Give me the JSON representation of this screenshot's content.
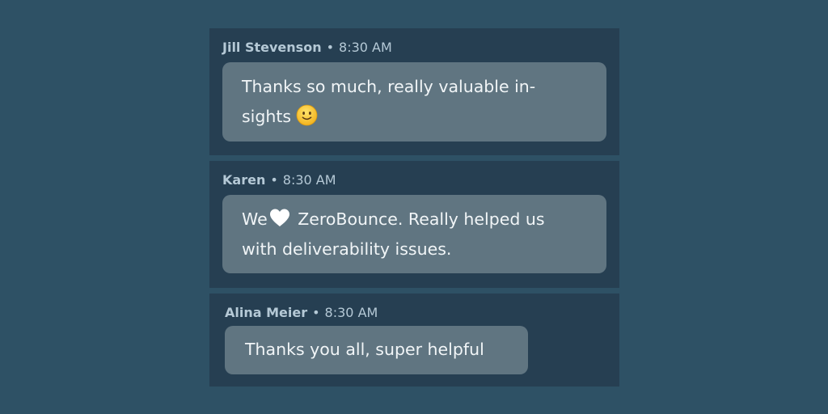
{
  "messages": [
    {
      "author": "Jill Stevenson",
      "separator": "•",
      "time": "8:30 AM",
      "text": "Thanks so much, really valuable in-sights",
      "text_line1": "Thanks so much, really valuable in-",
      "text_line2": "sights",
      "emoji": "slightly-smiling-face-icon"
    },
    {
      "author": "Karen",
      "separator": "•",
      "time": "8:30 AM",
      "text_prefix": "We",
      "icon": "heart-icon",
      "text_line1_rest": " ZeroBounce. Really helped us",
      "text_line2": "with deliverability issues."
    },
    {
      "author": "Alina Meier",
      "separator": "•",
      "time": "8:30 AM",
      "text": "Thanks you all, super helpful"
    }
  ],
  "colors": {
    "background": "#2e5165",
    "card": "#263f52",
    "bubble": "#607581",
    "meta_text": "#b5c9d6",
    "message_text": "#f1f5f7"
  }
}
